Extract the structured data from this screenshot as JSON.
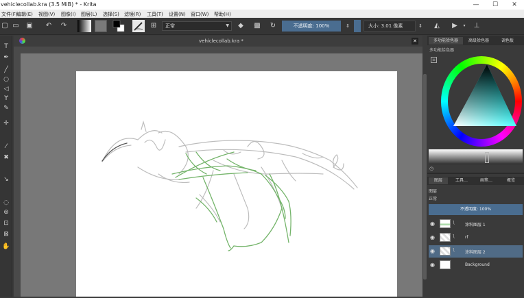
{
  "window": {
    "title": "vehiclecollab.kra (3.5 MiB)  * - Krita",
    "controls": [
      "—",
      "☐",
      "✕"
    ]
  },
  "menu": [
    "文件(F)",
    "编辑(E)",
    "视图(V)",
    "图像(I)",
    "图层(L)",
    "选择(S)",
    "滤镜(R)",
    "工具(T)",
    "设置(N)",
    "窗口(W)",
    "帮助(H)"
  ],
  "toolbar": {
    "blend_mode": "正常",
    "opacity_label": "不透明度: 100%",
    "size_label": "大小: 3.01 像素"
  },
  "document": {
    "tab_name": "vehiclecollab.kra *",
    "close_glyph": "✕"
  },
  "color_panel": {
    "tabs": [
      "多功能拾色器",
      "高级拾色器",
      "调色板"
    ],
    "subtitle": "多功能拾色器"
  },
  "layers_panel": {
    "tabs": [
      "图层",
      "工具…",
      "画笔…",
      "概览"
    ],
    "mode_label": "图层",
    "blend_value": "正常",
    "opacity_label": "不透明度: 100%",
    "layers": [
      {
        "name": "涂料图层 1",
        "selected": false
      },
      {
        "name": "rf",
        "selected": false
      },
      {
        "name": "涂料图层 2",
        "selected": true
      },
      {
        "name": "Background",
        "selected": false
      }
    ]
  },
  "colors": {
    "accent": "#4a6d90",
    "selection": "#506b86",
    "canvas": "#ffffff",
    "viewport": "#787878",
    "sketch_gray": "#bdbdbd",
    "sketch_green": "#74b46a"
  }
}
